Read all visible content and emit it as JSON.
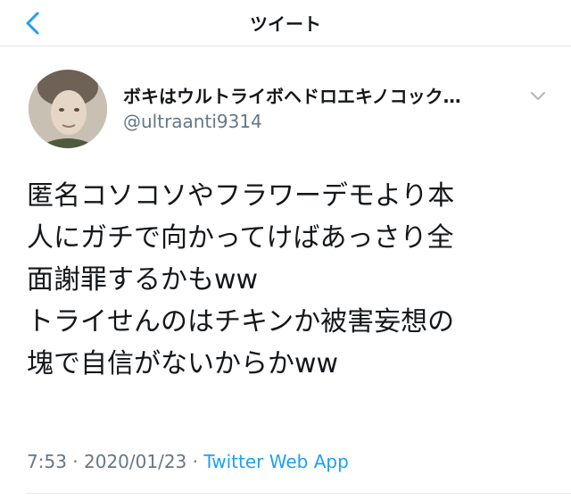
{
  "header": {
    "title": "ツイート",
    "back_icon": "chevron-left-icon",
    "accent": "#1da1f2"
  },
  "tweet": {
    "author": {
      "display_name": "ボキはウルトライボヘドロエキノコック…",
      "handle": "@ultraanti9314"
    },
    "text_lines": [
      "匿名コソコソやフラワーデモより本",
      "人にガチで向かってけばあっさり全",
      "面謝罪するかもww",
      "トライせんのはチキンか被害妄想の",
      "塊で自信がないからかww"
    ],
    "time": "7:53",
    "date": "2020/01/23",
    "separator": "·",
    "source": "Twitter Web App"
  }
}
